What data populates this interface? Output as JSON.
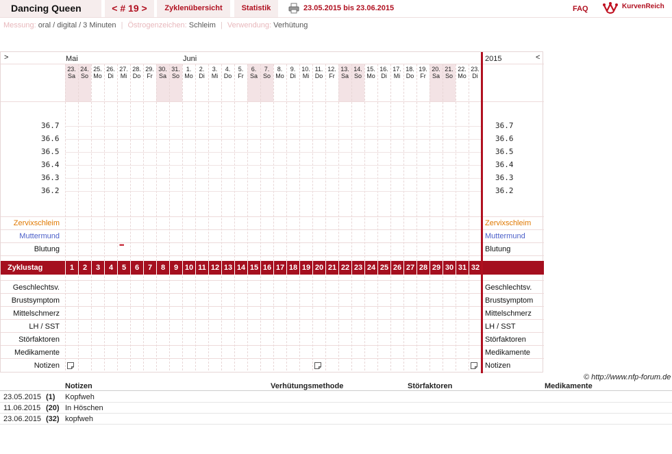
{
  "header": {
    "title": "Dancing Queen",
    "cycle_nav": "< # 19 >",
    "tab_overview": "Zyklenübersicht",
    "tab_stats": "Statistik",
    "date_range": "23.05.2015 bis 23.06.2015",
    "faq": "FAQ",
    "logo_text": "KurvenReich"
  },
  "settings": {
    "measurement_label": "Messung:",
    "measurement_value": "oral / digital / 3 Minuten",
    "estrogen_label": "Östrogenzeichen:",
    "estrogen_value": "Schleim",
    "usage_label": "Verwendung:",
    "usage_value": "Verhütung"
  },
  "chart": {
    "nav_left": ">",
    "nav_right": "<",
    "year": "2015",
    "month_may": "Mai",
    "month_june": "Juni",
    "days": [
      {
        "d": "23.",
        "w": "Sa",
        "we": true
      },
      {
        "d": "24.",
        "w": "So",
        "we": true
      },
      {
        "d": "25.",
        "w": "Mo",
        "we": false
      },
      {
        "d": "26.",
        "w": "Di",
        "we": false
      },
      {
        "d": "27.",
        "w": "Mi",
        "we": false
      },
      {
        "d": "28.",
        "w": "Do",
        "we": false
      },
      {
        "d": "29.",
        "w": "Fr",
        "we": false
      },
      {
        "d": "30.",
        "w": "Sa",
        "we": true
      },
      {
        "d": "31.",
        "w": "So",
        "we": true
      },
      {
        "d": "1.",
        "w": "Mo",
        "we": false
      },
      {
        "d": "2.",
        "w": "Di",
        "we": false
      },
      {
        "d": "3.",
        "w": "Mi",
        "we": false
      },
      {
        "d": "4.",
        "w": "Do",
        "we": false
      },
      {
        "d": "5.",
        "w": "Fr",
        "we": false
      },
      {
        "d": "6.",
        "w": "Sa",
        "we": true
      },
      {
        "d": "7.",
        "w": "So",
        "we": true
      },
      {
        "d": "8.",
        "w": "Mo",
        "we": false
      },
      {
        "d": "9.",
        "w": "Di",
        "we": false
      },
      {
        "d": "10.",
        "w": "Mi",
        "we": false
      },
      {
        "d": "11.",
        "w": "Do",
        "we": false
      },
      {
        "d": "12.",
        "w": "Fr",
        "we": false
      },
      {
        "d": "13.",
        "w": "Sa",
        "we": true
      },
      {
        "d": "14.",
        "w": "So",
        "we": true
      },
      {
        "d": "15.",
        "w": "Mo",
        "we": false
      },
      {
        "d": "16.",
        "w": "Di",
        "we": false
      },
      {
        "d": "17.",
        "w": "Mi",
        "we": false
      },
      {
        "d": "18.",
        "w": "Do",
        "we": false
      },
      {
        "d": "19.",
        "w": "Fr",
        "we": false
      },
      {
        "d": "20.",
        "w": "Sa",
        "we": true
      },
      {
        "d": "21.",
        "w": "So",
        "we": true
      },
      {
        "d": "22.",
        "w": "Mo",
        "we": false
      },
      {
        "d": "23.",
        "w": "Di",
        "we": false
      }
    ],
    "temps": [
      "36.7",
      "36.6",
      "36.5",
      "36.4",
      "36.3",
      "36.2"
    ],
    "row_labels": {
      "cervical_mucus": "Zervixschleim",
      "cervix": "Muttermund",
      "bleeding": "Blutung",
      "cycle_day": "Zyklustag",
      "intercourse": "Geschlechtsv.",
      "breast": "Brustsymptom",
      "midpain": "Mittelschmerz",
      "lh": "LH / SST",
      "disturbances": "Störfaktoren",
      "medication": "Medikamente",
      "notes": "Notizen"
    },
    "colors": {
      "cervical_mucus": "#e07800",
      "cervix": "#4a5ec8",
      "accent": "#a50f1f",
      "weekend": "#f3e3e5"
    },
    "bleeding_day": 5,
    "bleeding_mark": "•••",
    "note_days": [
      1,
      20,
      32
    ]
  },
  "copyright": "© http://www.nfp-forum.de",
  "notes_table": {
    "headers": {
      "notes": "Notizen",
      "contraception": "Verhütungsmethode",
      "disturbances": "Störfaktoren",
      "medication": "Medikamente"
    },
    "rows": [
      {
        "date": "23.05.2015",
        "day": "(1)",
        "note": "Kopfweh"
      },
      {
        "date": "11.06.2015",
        "day": "(20)",
        "note": "In Höschen"
      },
      {
        "date": "23.06.2015",
        "day": "(32)",
        "note": "kopfweh"
      }
    ]
  }
}
